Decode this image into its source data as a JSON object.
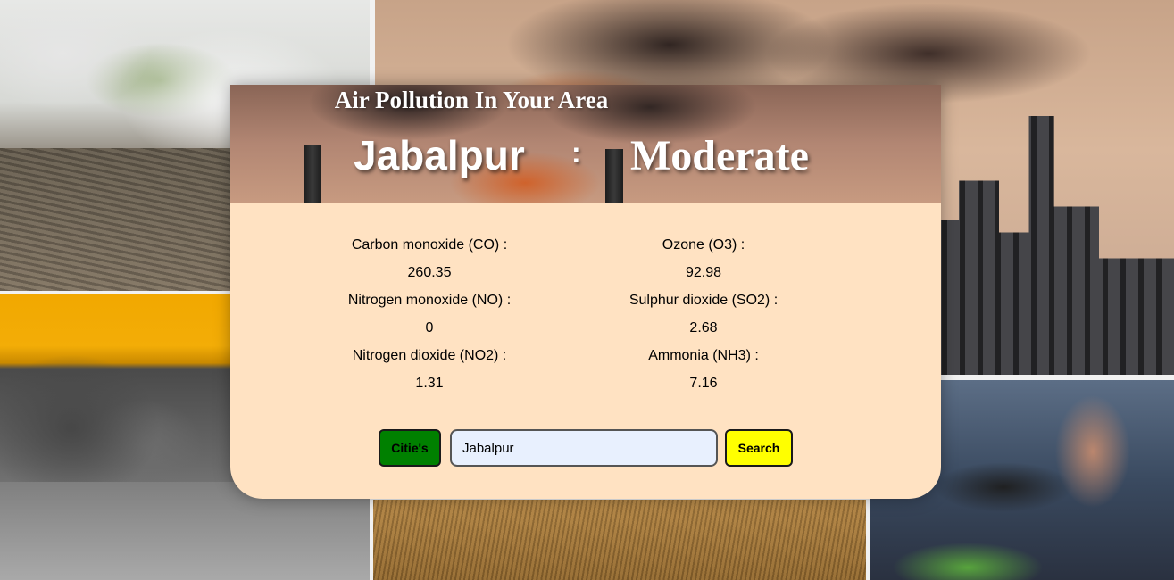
{
  "header": {
    "title": "Air Pollution In Your Area",
    "city": "Jabalpur",
    "separator": ":",
    "level": "Moderate"
  },
  "pollutants": {
    "left": [
      {
        "label": "Carbon monoxide (CO) :",
        "value": "260.35"
      },
      {
        "label": "Nitrogen monoxide (NO) :",
        "value": "0"
      },
      {
        "label": "Nitrogen dioxide (NO2) :",
        "value": "1.31"
      }
    ],
    "right": [
      {
        "label": "Ozone (O3) :",
        "value": "92.98"
      },
      {
        "label": "Sulphur dioxide (SO2) :",
        "value": "2.68"
      },
      {
        "label": "Ammonia (NH3) :",
        "value": "7.16"
      }
    ]
  },
  "controls": {
    "cities_label": "Citie's",
    "search_value": "Jabalpur",
    "search_label": "Search"
  },
  "colors": {
    "card_body": "#ffe2c2",
    "cities_button": "#008000",
    "search_button": "#ffff00",
    "input_bg": "#e8f0fe"
  }
}
